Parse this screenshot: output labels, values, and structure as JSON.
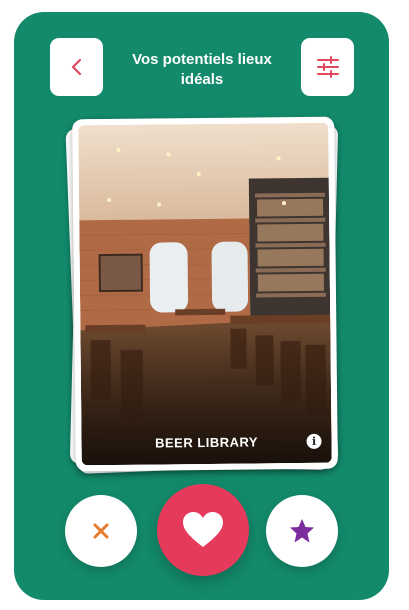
{
  "header": {
    "title": "Vos potentiels lieux idéals",
    "back_icon": "chevron-left-icon",
    "filter_icon": "sliders-icon"
  },
  "card": {
    "name": "BEER LIBRARY",
    "info_label": "i",
    "photo": "restaurant-interior-photo"
  },
  "actions": {
    "dislike_icon": "close-icon",
    "like_icon": "heart-icon",
    "favorite_icon": "star-icon"
  },
  "colors": {
    "background": "#138a6b",
    "accent_red": "#e53a5b",
    "dislike_orange": "#e9782f",
    "favorite_purple": "#7b2d9c",
    "icon_red": "#e0485f"
  }
}
